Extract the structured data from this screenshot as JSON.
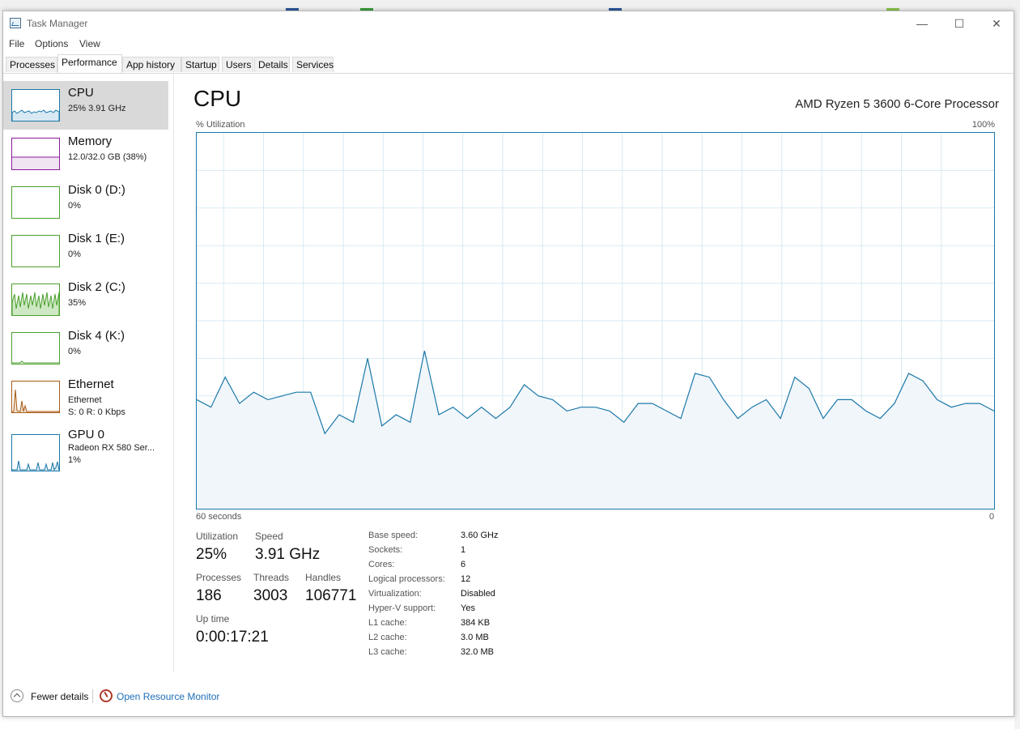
{
  "window": {
    "title": "Task Manager",
    "controls": {
      "minimize": "—",
      "maximize": "☐",
      "close": "✕"
    }
  },
  "menu": {
    "file": "File",
    "options": "Options",
    "view": "View"
  },
  "tabs": [
    "Processes",
    "Performance",
    "App history",
    "Startup",
    "Users",
    "Details",
    "Services"
  ],
  "active_tab": "Performance",
  "sidebar": {
    "items": [
      {
        "name": "CPU",
        "sub1": "25% 3.91 GHz",
        "color": "#1a78a8"
      },
      {
        "name": "Memory",
        "sub1": "12.0/32.0 GB (38%)",
        "color": "#8b1a9a"
      },
      {
        "name": "Disk 0 (D:)",
        "sub1": "0%",
        "color": "#4aa02c"
      },
      {
        "name": "Disk 1 (E:)",
        "sub1": "0%",
        "color": "#4aa02c"
      },
      {
        "name": "Disk 2 (C:)",
        "sub1": "35%",
        "color": "#4aa02c"
      },
      {
        "name": "Disk 4 (K:)",
        "sub1": "0%",
        "color": "#4aa02c"
      },
      {
        "name": "Ethernet",
        "sub1": "Ethernet",
        "sub2": "S: 0 R: 0 Kbps",
        "color": "#a75a14"
      },
      {
        "name": "GPU 0",
        "sub1": "Radeon RX 580 Ser...",
        "sub2": "1%",
        "color": "#1a78a8"
      }
    ]
  },
  "main": {
    "title": "CPU",
    "processor": "AMD Ryzen 5 3600 6-Core Processor",
    "graph_label_top_left": "% Utilization",
    "graph_label_top_right": "100%",
    "graph_label_bottom_left": "60 seconds",
    "graph_label_bottom_right": "0",
    "cpu_history_percent": [
      29,
      27,
      35,
      28,
      31,
      29,
      30,
      31,
      31,
      20,
      25,
      23,
      40,
      22,
      25,
      23,
      42,
      25,
      27,
      24,
      27,
      24,
      27,
      33,
      30,
      29,
      26,
      27,
      27,
      26,
      23,
      28,
      28,
      26,
      24,
      36,
      35,
      29,
      24,
      27,
      29,
      24,
      35,
      32,
      24,
      29,
      29,
      26,
      24,
      28,
      36,
      34,
      29,
      27,
      28,
      28,
      26
    ]
  },
  "stats": {
    "utilization_label": "Utilization",
    "utilization_value": "25%",
    "speed_label": "Speed",
    "speed_value": "3.91 GHz",
    "processes_label": "Processes",
    "processes_value": "186",
    "threads_label": "Threads",
    "threads_value": "3003",
    "handles_label": "Handles",
    "handles_value": "106771",
    "uptime_label": "Up time",
    "uptime_value": "0:00:17:21"
  },
  "specs": [
    {
      "label": "Base speed:",
      "value": "3.60 GHz"
    },
    {
      "label": "Sockets:",
      "value": "1"
    },
    {
      "label": "Cores:",
      "value": "6"
    },
    {
      "label": "Logical processors:",
      "value": "12"
    },
    {
      "label": "Virtualization:",
      "value": "Disabled"
    },
    {
      "label": "Hyper-V support:",
      "value": "Yes"
    },
    {
      "label": "L1 cache:",
      "value": "384 KB"
    },
    {
      "label": "L2 cache:",
      "value": "3.0 MB"
    },
    {
      "label": "L3 cache:",
      "value": "32.0 MB"
    }
  ],
  "footer": {
    "fewer_details": "Fewer details",
    "resource_monitor": "Open Resource Monitor"
  }
}
